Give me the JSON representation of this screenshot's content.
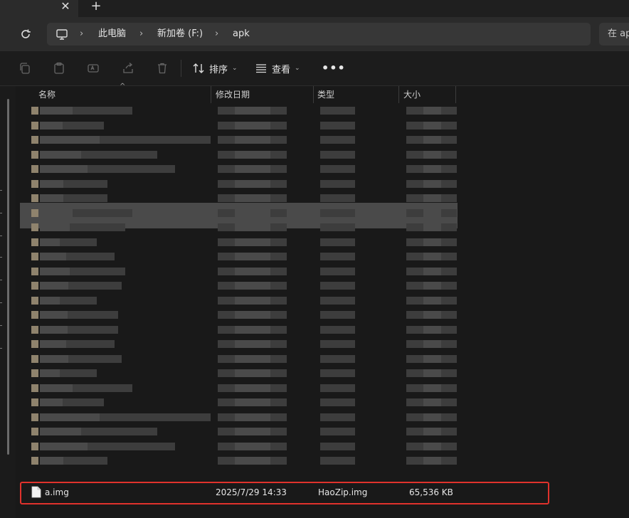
{
  "tabs": {
    "close_glyph": "✕",
    "new_glyph": "+"
  },
  "breadcrumb": [
    "此电脑",
    "新加卷 (F:)",
    "apk"
  ],
  "search": {
    "text": "在 apk"
  },
  "toolbar": {
    "sort_label": "排序",
    "view_label": "查看",
    "more_label": "•••"
  },
  "columns": [
    "名称",
    "修改日期",
    "类型",
    "大小"
  ],
  "file": {
    "name": "a.img",
    "modified": "2025/7/29 14:33",
    "type": "HaoZip.img",
    "size": "65,536 KB"
  },
  "colors": {
    "background": "#191919",
    "selection_outline": "#e0322c",
    "address_bar": "#373737"
  },
  "icons": [
    "close-icon",
    "add-icon",
    "refresh-icon",
    "monitor-icon",
    "chevron-right-icon",
    "copy-icon",
    "paste-icon",
    "rename-icon",
    "share-icon",
    "delete-icon",
    "sort-icon",
    "view-icon",
    "more-icon",
    "file-icon"
  ]
}
